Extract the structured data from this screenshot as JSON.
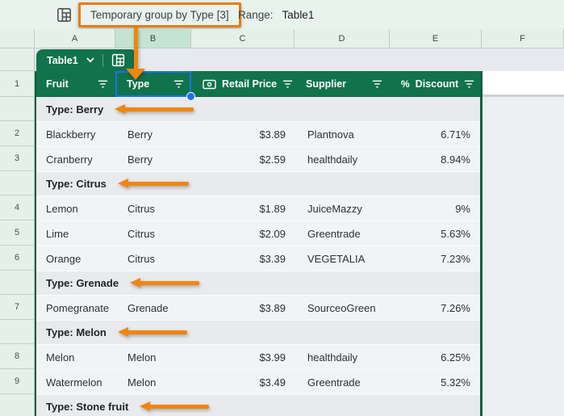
{
  "top_bar": {
    "group_label": "Temporary group by Type [3]",
    "range_label": "Range:",
    "range_value": "Table1"
  },
  "colstrip": {
    "letters": [
      "A",
      "B",
      "C",
      "D",
      "E",
      "F"
    ],
    "selected_column": "B"
  },
  "table_chip": {
    "name": "Table1"
  },
  "header": {
    "fruit": "Fruit",
    "type": "Type",
    "retail_price": "Retail Price",
    "supplier": "Supplier",
    "discount": "Discount"
  },
  "icons": {
    "table_grid": "table-grid",
    "filter": "filter-lines",
    "money": "banknote",
    "percent": "%",
    "chevron_down": "chevron-down"
  },
  "gutter": [
    "",
    "1",
    "",
    "2",
    "3",
    "",
    "4",
    "5",
    "6",
    "",
    "7",
    "",
    "8",
    "9",
    ""
  ],
  "rows": [
    {
      "kind": "group",
      "label": "Type: Berry"
    },
    {
      "kind": "data",
      "fruit": "Blackberry",
      "type": "Berry",
      "price": "$3.89",
      "supplier": "Plantnova",
      "discount": "6.71%"
    },
    {
      "kind": "data",
      "fruit": "Cranberry",
      "type": "Berry",
      "price": "$2.59",
      "supplier": "healthdaily",
      "discount": "8.94%"
    },
    {
      "kind": "group",
      "label": "Type: Citrus"
    },
    {
      "kind": "data",
      "fruit": "Lemon",
      "type": "Citrus",
      "price": "$1.89",
      "supplier": "JuiceMazzy",
      "discount": "9%"
    },
    {
      "kind": "data",
      "fruit": "Lime",
      "type": "Citrus",
      "price": "$2.09",
      "supplier": "Greentrade",
      "discount": "5.63%"
    },
    {
      "kind": "data",
      "fruit": "Orange",
      "type": "Citrus",
      "price": "$3.39",
      "supplier": "VEGETALIA",
      "discount": "7.23%"
    },
    {
      "kind": "group",
      "label": "Type: Grenade"
    },
    {
      "kind": "data",
      "fruit": "Pomegranate",
      "type": "Grenade",
      "price": "$3.89",
      "supplier": "SourceoGreen",
      "discount": "7.26%"
    },
    {
      "kind": "group",
      "label": "Type: Melon"
    },
    {
      "kind": "data",
      "fruit": "Melon",
      "type": "Melon",
      "price": "$3.99",
      "supplier": "healthdaily",
      "discount": "6.25%"
    },
    {
      "kind": "data",
      "fruit": "Watermelon",
      "type": "Melon",
      "price": "$3.49",
      "supplier": "Greentrade",
      "discount": "5.32%"
    },
    {
      "kind": "group",
      "label": "Type: Stone fruit"
    }
  ],
  "colors": {
    "header_green": "#11734b",
    "accent_orange": "#e87c0e",
    "selection_blue": "#1a73e8",
    "group_row_gray": "#e8eaed",
    "data_row_gray": "#f1f3f4",
    "light_green_bg": "#e9f3ee"
  }
}
